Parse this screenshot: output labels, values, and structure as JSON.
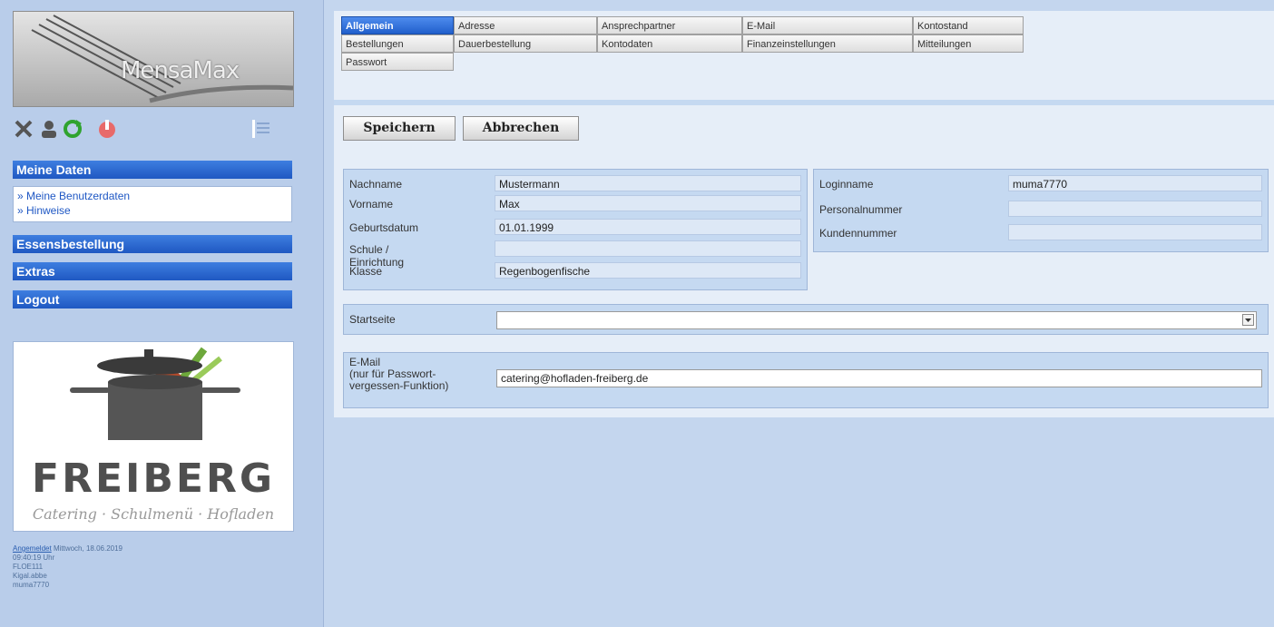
{
  "sidebar": {
    "logo_text": "MensaMax",
    "icons": [
      "close-x-icon",
      "user-icon",
      "refresh-icon",
      "power-icon",
      "menu-icon"
    ],
    "sections": [
      {
        "label": "Meine Daten",
        "items": [
          "» Meine Benutzerdaten",
          "» Hinweise"
        ]
      },
      {
        "label": "Essensbestellung"
      },
      {
        "label": "Extras"
      },
      {
        "label": "Logout"
      }
    ],
    "caterer_logo": {
      "title": "FREIBERG",
      "subtitle": "Catering · Schulmenü · Hofladen"
    },
    "status": {
      "login_label": "Angemeldet",
      "login_date": "Mittwoch, 18.06.2019",
      "time": "09:40:19 Uhr",
      "code": "FLOE111",
      "user1": "Kigal.abbe",
      "user2": "muma7770"
    }
  },
  "tabs": [
    {
      "label": "Allgemein",
      "active": true
    },
    {
      "label": "Adresse"
    },
    {
      "label": "Ansprechpartner"
    },
    {
      "label": "E-Mail"
    },
    {
      "label": "Kontostand"
    },
    {
      "label": "Bestellungen"
    },
    {
      "label": "Dauerbestellung"
    },
    {
      "label": "Kontodaten"
    },
    {
      "label": "Finanzeinstellungen"
    },
    {
      "label": "Mitteilungen"
    },
    {
      "label": "Passwort"
    }
  ],
  "buttons": {
    "save": "Speichern",
    "cancel": "Abbrechen"
  },
  "personal": [
    {
      "label": "Nachname",
      "value": "Mustermann"
    },
    {
      "label": "Vorname",
      "value": "Max"
    },
    {
      "label": "Geburtsdatum",
      "value": "01.01.1999"
    },
    {
      "label": "Schule / Einrichtung",
      "value": ""
    },
    {
      "label": "Klasse",
      "value": "Regenbogenfische"
    }
  ],
  "account": [
    {
      "label": "Loginname",
      "value": "muma7770"
    },
    {
      "label": "Personalnummer",
      "value": ""
    },
    {
      "label": "Kundennummer",
      "value": ""
    }
  ],
  "startseite": {
    "label": "Startseite",
    "value": ""
  },
  "email": {
    "label_line1": "E-Mail",
    "label_line2": "(nur für Passwort-",
    "label_line3": "vergessen-Funktion)",
    "value": "catering@hofladen-freiberg.de"
  },
  "colors": {
    "accent": "#2a64d2",
    "panel": "#e6eef8",
    "background": "#c4d6ee"
  }
}
